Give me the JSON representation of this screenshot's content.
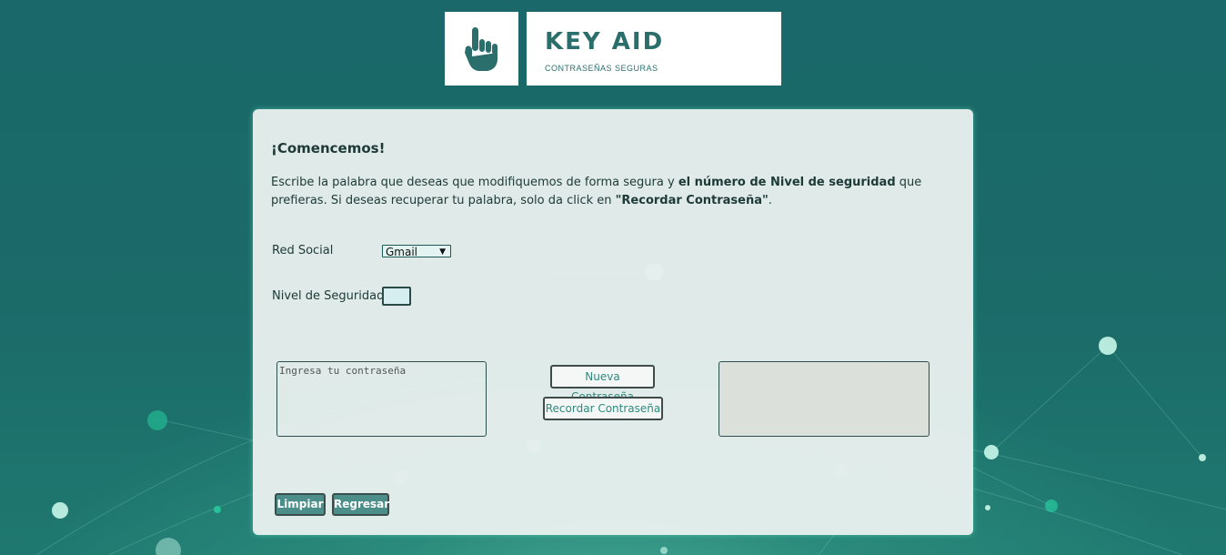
{
  "brand": {
    "name": "KEY AID",
    "tagline": "CONTRASEÑAS SEGURAS",
    "icon": "pointing-hand-icon"
  },
  "main": {
    "heading": "¡Comencemos!",
    "intro_part1": "Escribe la palabra que deseas que modifiquemos de forma segura y ",
    "intro_bold1": "el número de Nivel de seguridad",
    "intro_part2": " que prefieras. Si deseas recuperar tu palabra, solo da click en ",
    "intro_bold2": "\"Recordar Contraseña\"",
    "intro_part3": "."
  },
  "form": {
    "social_label": "Red Social",
    "social_value": "Gmail",
    "level_label": "Nivel de Seguridad",
    "level_value": "",
    "password_placeholder": "Ingresa tu contraseña",
    "new_password_button": "Nueva Contraseña",
    "recall_password_button": "Recordar Contraseña",
    "output_value": ""
  },
  "actions": {
    "clear_button": "Limpiar",
    "back_button": "Regresar"
  },
  "colors": {
    "background": "#1b6b69",
    "accent": "#2a6f6b",
    "button": "#4c8e8a"
  }
}
